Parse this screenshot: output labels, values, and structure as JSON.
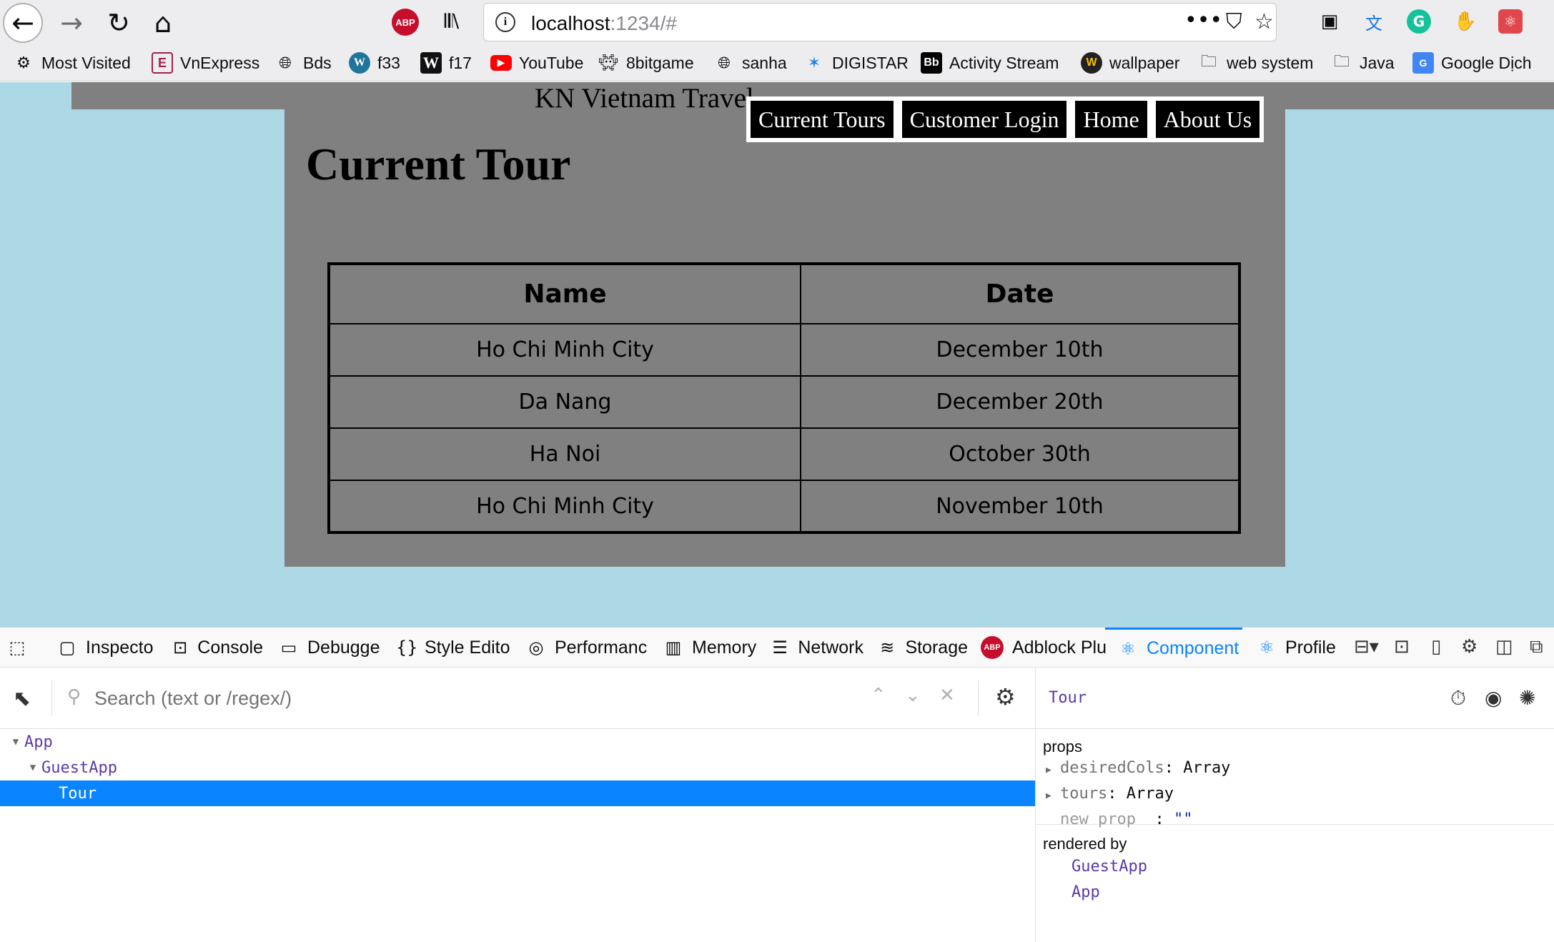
{
  "browser": {
    "url_host": "localhost",
    "url_path": ":1234/#",
    "extensions": {
      "adblock_label": "ABP"
    }
  },
  "bookmarks": [
    {
      "label": "Most Visited",
      "icon": "gear-icon"
    },
    {
      "label": "VnExpress",
      "icon": "vnexpress-icon"
    },
    {
      "label": "Bds",
      "icon": "globe-icon"
    },
    {
      "label": "f33",
      "icon": "wordpress-icon"
    },
    {
      "label": "f17",
      "icon": "f17-icon"
    },
    {
      "label": "YouTube",
      "icon": "youtube-icon"
    },
    {
      "label": "8bitgame",
      "icon": "invader-icon"
    },
    {
      "label": "sanha",
      "icon": "globe-icon"
    },
    {
      "label": "DIGISTAR",
      "icon": "star-icon"
    },
    {
      "label": "Activity Stream",
      "icon": "blackboard-icon",
      "badge": "Bb"
    },
    {
      "label": "wallpaper",
      "icon": "w-icon",
      "badge": "W"
    },
    {
      "label": "web system",
      "icon": "folder-icon"
    },
    {
      "label": "Java",
      "icon": "folder-icon"
    },
    {
      "label": "Google Dịch",
      "icon": "google-translate-icon"
    }
  ],
  "page": {
    "site_title": "KN Vietnam Travel",
    "nav": [
      "Current Tours",
      "Customer Login",
      "Home",
      "About Us"
    ],
    "heading": "Current Tour",
    "table": {
      "columns": [
        "Name",
        "Date"
      ],
      "rows": [
        [
          "Ho Chi Minh City",
          "December 10th"
        ],
        [
          "Da Nang",
          "December 20th"
        ],
        [
          "Ha Noi",
          "October 30th"
        ],
        [
          "Ho Chi Minh City",
          "November 10th"
        ]
      ]
    },
    "colors": {
      "background": "#add8e6",
      "panel": "#808080",
      "nav_bg": "#000000"
    }
  },
  "devtools": {
    "tabs": [
      "Inspector",
      "Console",
      "Debugger",
      "Style Editor",
      "Performance",
      "Memory",
      "Network",
      "Storage",
      "Adblock Plus",
      "Components",
      "Profiler"
    ],
    "tabs_display": [
      "Inspecto",
      "Console",
      "Debugge",
      "Style Edito",
      "Performanc",
      "Memory",
      "Network",
      "Storage",
      "Adblock Plu",
      "Component",
      "Profile"
    ],
    "selected_tab": "Components",
    "search": {
      "placeholder": "Search (text or /regex/)",
      "value": ""
    },
    "tree": [
      {
        "name": "App",
        "depth": 0,
        "expanded": true
      },
      {
        "name": "GuestApp",
        "depth": 1,
        "expanded": true
      },
      {
        "name": "Tour",
        "depth": 2,
        "selected": true
      }
    ],
    "selected_component": "Tour",
    "props_label": "props",
    "props": [
      {
        "key": "desiredCols",
        "value": "Array"
      },
      {
        "key": "tours",
        "value": "Array"
      }
    ],
    "new_prop": {
      "key": "new prop",
      "value": "\"\""
    },
    "rendered_by_label": "rendered by",
    "rendered_by": [
      "GuestApp",
      "App"
    ],
    "accent_color": "#0a84ff"
  }
}
